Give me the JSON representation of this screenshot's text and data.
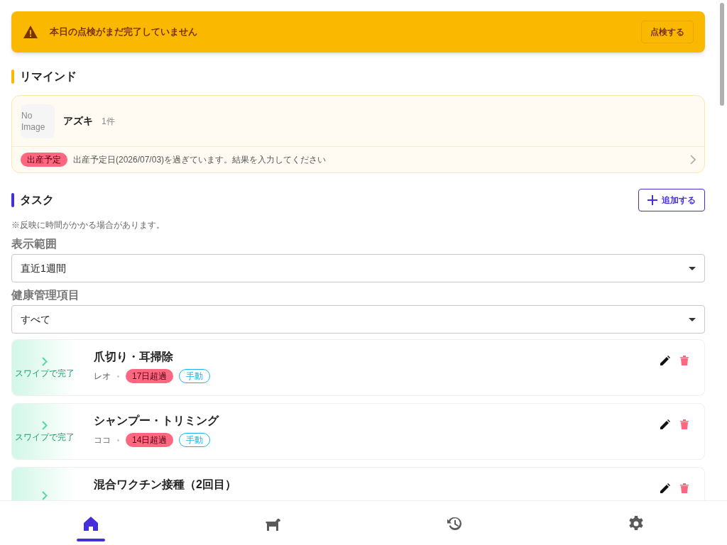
{
  "alert": {
    "message": "本日の点検がまだ完了していません",
    "button": "点検する"
  },
  "remind": {
    "title": "リマインド",
    "items": [
      {
        "image_text": "No Image",
        "name": "アズキ",
        "count": "1件",
        "tag": "出産予定",
        "message": "出産予定日(2026/07/03)を過ぎています。結果を入力してください"
      }
    ]
  },
  "tasks": {
    "title": "タスク",
    "add_button": "追加する",
    "note": "※反映に時間がかかる場合があります。",
    "filters": [
      {
        "label": "表示範囲",
        "value": "直近1週間"
      },
      {
        "label": "健康管理項目",
        "value": "すべて"
      }
    ],
    "items": [
      {
        "swipe_hint": "スワイプで完了",
        "title": "爪切り・耳掃除",
        "pet": "レオ",
        "overdue": "17日超過",
        "tag": "手動"
      },
      {
        "swipe_hint": "スワイプで完了",
        "title": "シャンプー・トリミング",
        "pet": "ココ",
        "overdue": "14日超過",
        "tag": "手動"
      },
      {
        "title": "混合ワクチン接種（2回目）"
      }
    ]
  },
  "nav": [
    {
      "kind": "home",
      "selected": true
    },
    {
      "kind": "dog",
      "selected": false
    },
    {
      "kind": "history",
      "selected": false
    },
    {
      "kind": "settings",
      "selected": false
    }
  ]
}
